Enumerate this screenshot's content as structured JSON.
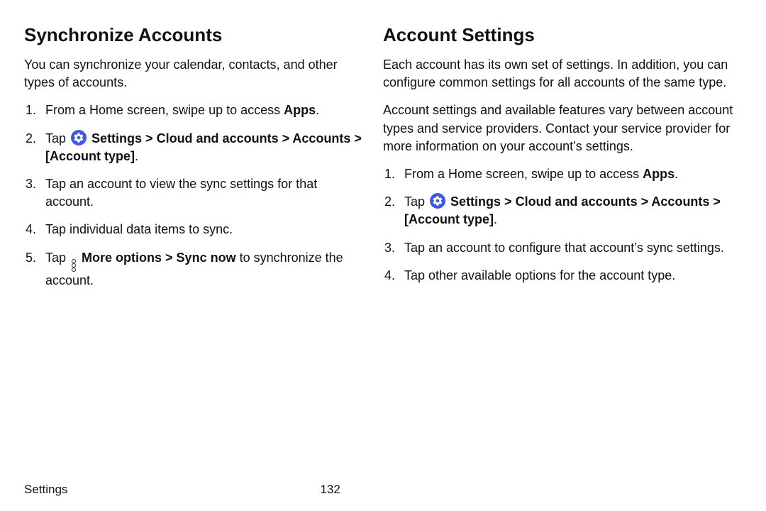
{
  "left": {
    "title": "Synchronize Accounts",
    "intro": "You can synchronize your calendar, contacts, and other types of accounts.",
    "steps": {
      "1_pre": "From a Home screen, swipe up to access ",
      "1_bold": "Apps",
      "1_post": ".",
      "2_pre": "Tap ",
      "2_bold": "Settings > Cloud and accounts > Accounts > [Account type]",
      "2_post": ".",
      "3": "Tap an account to view the sync settings for that account.",
      "4": "Tap individual data items to sync.",
      "5_pre": "Tap ",
      "5_bold": "More options > Sync now",
      "5_post": " to synchronize the account."
    }
  },
  "right": {
    "title": "Account Settings",
    "intro1": "Each account has its own set of settings. In addition, you can configure common settings for all accounts of the same type.",
    "intro2": "Account settings and available features vary between account types and service providers. Contact your service provider for more information on your account’s settings.",
    "steps": {
      "1_pre": "From a Home screen, swipe up to access ",
      "1_bold": "Apps",
      "1_post": ".",
      "2_pre": "Tap ",
      "2_bold": "Settings > Cloud and accounts > Accounts > [Account type]",
      "2_post": ".",
      "3": "Tap an account to configure that account’s sync settings.",
      "4": "Tap other available options for the account type."
    }
  },
  "footer": {
    "section": "Settings",
    "page": "132"
  }
}
